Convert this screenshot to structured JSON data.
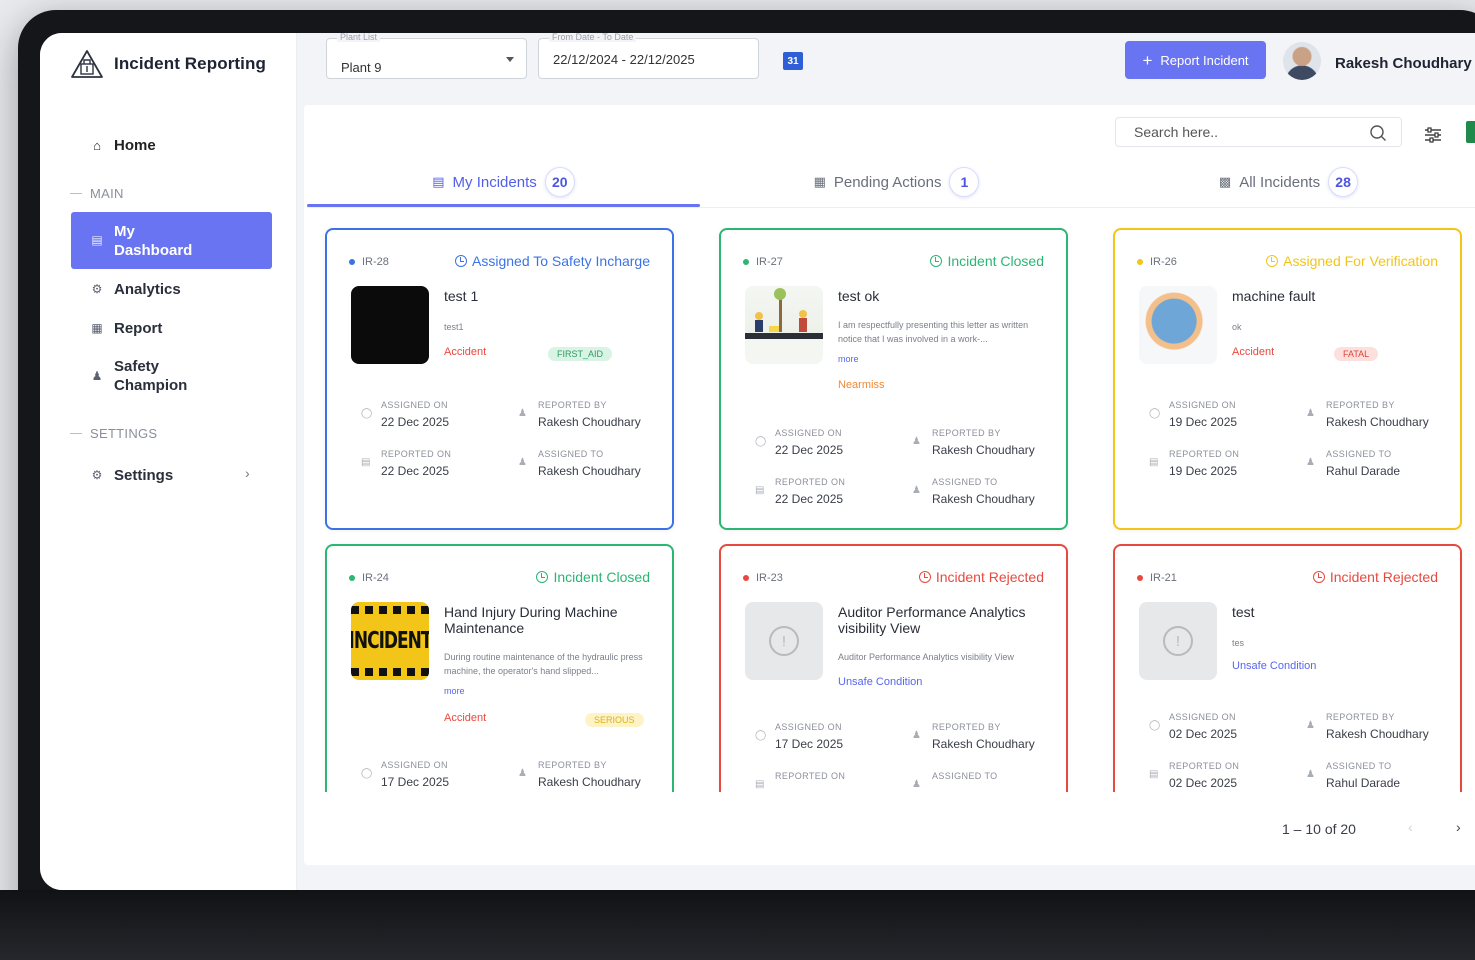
{
  "app": {
    "title": "Incident Reporting"
  },
  "sidebar": {
    "home": "Home",
    "main_label": "MAIN",
    "items": [
      {
        "label": "My Dashboard",
        "icon": "dashboard-icon",
        "active": true
      },
      {
        "label": "Analytics",
        "icon": "analytics-icon"
      },
      {
        "label": "Report",
        "icon": "report-icon"
      },
      {
        "label": "Safety Champion",
        "icon": "champion-icon"
      }
    ],
    "settings_label": "SETTINGS",
    "settings": "Settings"
  },
  "topbar": {
    "plant_label": "Plant List",
    "plant_value": "Plant 9",
    "date_label": "From Date - To Date",
    "date_value": "22/12/2024 - 22/12/2025",
    "calendar": "31",
    "report_button": "Report Incident",
    "user_name": "Rakesh Choudhary"
  },
  "search": {
    "placeholder": "Search here.."
  },
  "tabs": [
    {
      "label": "My Incidents",
      "count": "20",
      "active": true
    },
    {
      "label": "Pending Actions",
      "count": "1"
    },
    {
      "label": "All Incidents",
      "count": "28"
    }
  ],
  "meta_labels": {
    "assigned_on": "ASSIGNED ON",
    "reported_by": "REPORTED BY",
    "reported_on": "REPORTED ON",
    "assigned_to": "ASSIGNED TO"
  },
  "colors": {
    "accent": "#6874f2",
    "blue": "#3b73e6",
    "green": "#2bb673",
    "yellow": "#f2c518",
    "red": "#e8493f"
  },
  "cards": [
    {
      "id": "IR-28",
      "status": "Assigned To Safety Incharge",
      "title": "test 1",
      "desc": "test1",
      "category": "Accident",
      "severity": "FIRST_AID",
      "assigned_on": "22 Dec 2025",
      "reported_by": "Rakesh Choudhary",
      "reported_on": "22 Dec 2025",
      "assigned_to": "Rakesh Choudhary"
    },
    {
      "id": "IR-27",
      "status": "Incident Closed",
      "title": "test ok",
      "desc": "I am respectfully presenting this letter as written notice that I was involved in a work-...",
      "more": "more",
      "category": "Nearmiss",
      "assigned_on": "22 Dec 2025",
      "reported_by": "Rakesh Choudhary",
      "reported_on": "22 Dec 2025",
      "assigned_to": "Rakesh Choudhary"
    },
    {
      "id": "IR-26",
      "status": "Assigned For Verification",
      "title": "machine fault",
      "desc": "ok",
      "category": "Accident",
      "severity": "FATAL",
      "assigned_on": "19 Dec 2025",
      "reported_by": "Rakesh Choudhary",
      "reported_on": "19 Dec 2025",
      "assigned_to": "Rahul Darade"
    },
    {
      "id": "IR-24",
      "status": "Incident Closed",
      "title": "Hand Injury During Machine Maintenance",
      "desc": "During routine maintenance of the hydraulic press machine, the operator's hand slipped...",
      "more": "more",
      "category": "Accident",
      "severity": "SERIOUS",
      "image_text": "INCIDENT",
      "assigned_on": "17 Dec 2025",
      "reported_by": "Rakesh Choudhary"
    },
    {
      "id": "IR-23",
      "status": "Incident Rejected",
      "title": "Auditor Performance Analytics visibility View",
      "desc": "Auditor Performance Analytics visibility View",
      "category": "Unsafe Condition",
      "assigned_on": "17 Dec 2025",
      "reported_by": "Rakesh Choudhary"
    },
    {
      "id": "IR-21",
      "status": "Incident Rejected",
      "title": "test",
      "desc": "tes",
      "category": "Unsafe Condition",
      "assigned_on": "02 Dec 2025",
      "reported_by": "Rakesh Choudhary",
      "reported_on": "02 Dec 2025",
      "assigned_to": "Rahul Darade"
    }
  ],
  "pagination": {
    "range": "1 – 10 of 20"
  }
}
